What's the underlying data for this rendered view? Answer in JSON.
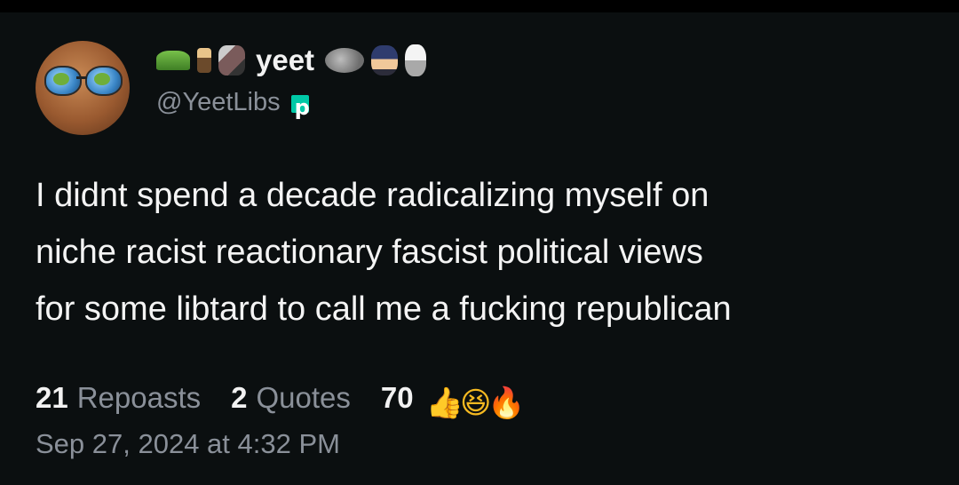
{
  "post": {
    "display_name": "yeet",
    "handle": "@YeetLibs",
    "badge_letter": "p",
    "text": "I didnt spend a decade radicalizing myself on\nniche racist reactionary fascist political views\nfor some libtard to call me a fucking republican",
    "timestamp": "Sep 27, 2024 at 4:32 PM"
  },
  "stats": {
    "repoasts_count": "21",
    "repoasts_label": "Repoasts",
    "quotes_count": "2",
    "quotes_label": "Quotes",
    "reactions_count": "70"
  },
  "icons": {
    "badge": "p-badge-icon",
    "reactions": [
      "thumbs-up-icon",
      "laughing-face-icon",
      "fire-icon"
    ],
    "name_emojis_left": [
      "frog-emoji-icon",
      "mini-figure-emoji-icon",
      "dancing-emoji-icon"
    ],
    "name_emojis_right": [
      "seal-emoji-icon",
      "anime-girl-emoji-icon",
      "maid-emoji-icon"
    ]
  },
  "colors": {
    "background": "#0b0f10",
    "text": "#f4f4f4",
    "muted": "#8a9099",
    "badge": "#00c9a7"
  }
}
